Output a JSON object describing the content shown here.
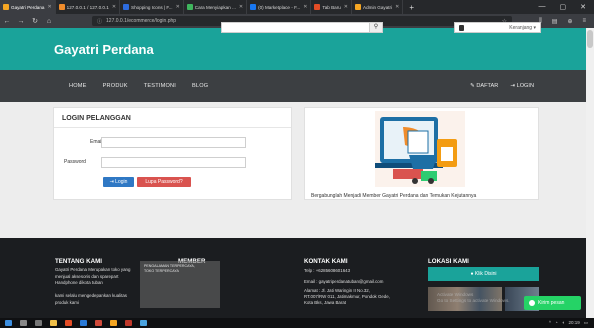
{
  "browser": {
    "tabs": [
      {
        "label": "Gayatri Perdana",
        "active": true
      },
      {
        "label": "127.0.0.1 / 127.0.0.1",
        "active": false
      },
      {
        "label": "Shopping Icons | F...",
        "active": false
      },
      {
        "label": "Cara Menyiapkan ...",
        "active": false
      },
      {
        "label": "(0) Marketplace - F...",
        "active": false
      },
      {
        "label": "Tab Baru",
        "active": false
      },
      {
        "label": "Admin Gayatri",
        "active": false
      }
    ],
    "new_tab": "+",
    "url": "127.0.0.1/ecommerce/login.php",
    "window_controls": [
      "—",
      "▢",
      "✕"
    ]
  },
  "header": {
    "brand": "Gayatri Perdana",
    "search_placeholder": "",
    "cart_label": "Keranjang ▾"
  },
  "menu": {
    "left": [
      "HOME",
      "PRODUK",
      "TESTIMONI",
      "BLOG"
    ],
    "right": [
      "DAFTAR",
      "LOGIN"
    ]
  },
  "login": {
    "title": "LOGIN PELANGGAN",
    "email_label": "Email",
    "password_label": "Password",
    "login_button": "Login",
    "forgot_button": "Lupa Password?"
  },
  "promo": {
    "caption": "Bergabunglah Menjadi Member Gayatri Perdana dan Temukan Kejutannya"
  },
  "footer": {
    "about_title": "TENTANG KAMI",
    "about_text": "Gayatri Perdana Merupakan toko yang menjual aksesoris dan sparepart Handphone dikota tuban",
    "about_text2": "kami selalu mengedepankan kualitas produk kami",
    "member_title": "MEMBER",
    "contact_title": "KONTAK KAMI",
    "contact_phone": "Telp : +6285608601643",
    "contact_email": "Email : gayatriperdanatuban@gmail.com",
    "contact_address1": "Alamat : Jl. Jati Waringin II No.32,",
    "contact_address2": "RT.007/RW 011, Jatimakmur, Pondok Gede,",
    "contact_address3": "Kota Bks, Jawa Barat",
    "location_title": "LOKASI KAMI",
    "location_button": "Klik Disini"
  },
  "overlay": {
    "line1": "PENGALAMAN TERPERCAYA,",
    "line2": "TOKO TERPERCAYA"
  },
  "watermark": {
    "line1": "Activate Windows",
    "line2": "Go to Settings to activate Windows."
  },
  "chat": {
    "label": "Kirim pesan"
  },
  "taskbar": {
    "time": "20:19"
  },
  "colors": {
    "teal": "#1aa39a",
    "menu": "#3c3f42",
    "footer": "#1b1d20",
    "blue": "#2f78c4",
    "red": "#d9534f"
  }
}
